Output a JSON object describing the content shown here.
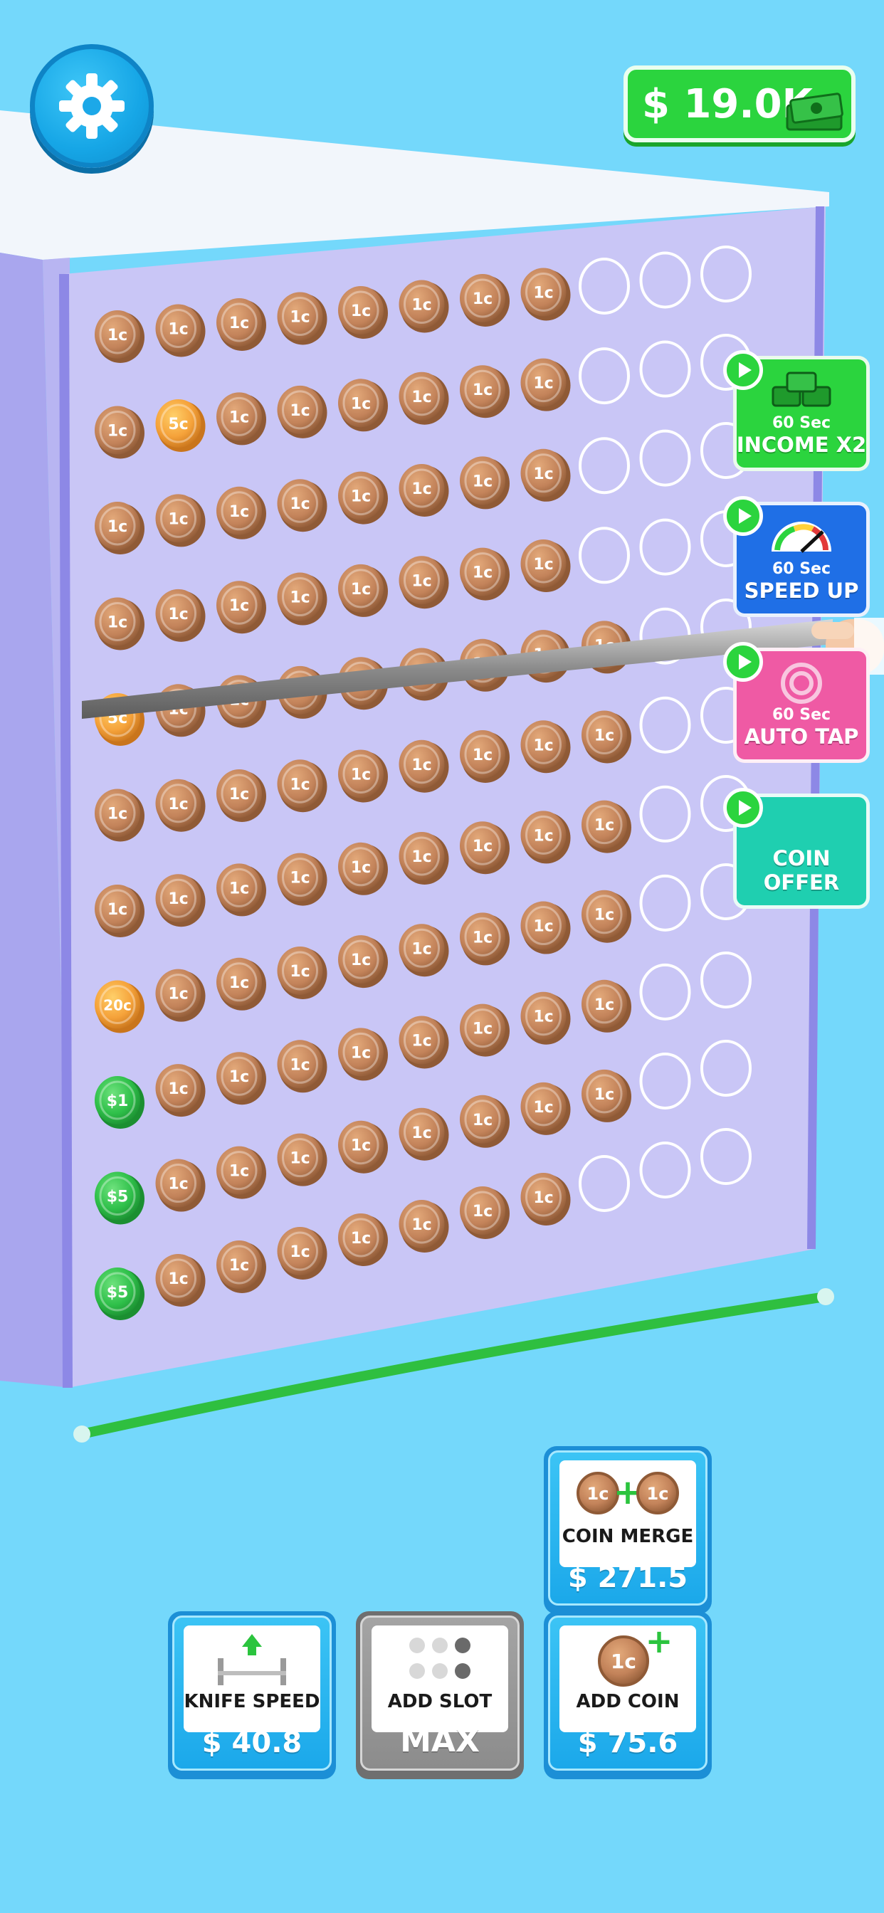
{
  "hud": {
    "money": "$ 19.0K",
    "settings_icon": "gear-icon"
  },
  "boosts": [
    {
      "timer": "60 Sec",
      "label": "INCOME X2",
      "color": "#2bd43e",
      "icon": "cash-stack-icon"
    },
    {
      "timer": "60 Sec",
      "label": "SPEED UP",
      "color": "#1f6fe6",
      "icon": "speedometer-icon"
    },
    {
      "timer": "60 Sec",
      "label": "AUTO TAP",
      "color": "#ef5aa4",
      "icon": "tap-icon"
    },
    {
      "timer": "",
      "label": "COIN OFFER",
      "color": "#1fcfb0",
      "icon": ""
    }
  ],
  "board": {
    "coin_labels": {
      "penny": "1c",
      "nickel": "5c",
      "twenty": "20c",
      "dollar": "$1",
      "five": "$5"
    },
    "rows": [
      [
        "1c",
        "1c",
        "1c",
        "1c",
        "1c",
        "1c",
        "1c",
        "1c",
        "",
        "",
        ""
      ],
      [
        "1c",
        "5c",
        "1c",
        "1c",
        "1c",
        "1c",
        "1c",
        "1c",
        "",
        "",
        ""
      ],
      [
        "1c",
        "1c",
        "1c",
        "1c",
        "1c",
        "1c",
        "1c",
        "1c",
        "",
        "",
        ""
      ],
      [
        "1c",
        "1c",
        "1c",
        "1c",
        "1c",
        "1c",
        "1c",
        "1c",
        "",
        "",
        ""
      ],
      [
        "5c",
        "1c",
        "1c",
        "1c",
        "1c",
        "1c",
        "1c",
        "1c",
        "1c",
        "",
        ""
      ],
      [
        "1c",
        "1c",
        "1c",
        "1c",
        "1c",
        "1c",
        "1c",
        "1c",
        "1c",
        "",
        ""
      ],
      [
        "1c",
        "1c",
        "1c",
        "1c",
        "1c",
        "1c",
        "1c",
        "1c",
        "1c",
        "",
        ""
      ],
      [
        "20c",
        "1c",
        "1c",
        "1c",
        "1c",
        "1c",
        "1c",
        "1c",
        "1c",
        "",
        ""
      ],
      [
        "$1",
        "1c",
        "1c",
        "1c",
        "1c",
        "1c",
        "1c",
        "1c",
        "1c",
        "",
        ""
      ],
      [
        "$5",
        "1c",
        "1c",
        "1c",
        "1c",
        "1c",
        "1c",
        "1c",
        "1c",
        "",
        ""
      ],
      [
        "$5",
        "1c",
        "1c",
        "1c",
        "1c",
        "1c",
        "1c",
        "1c",
        "",
        "",
        ""
      ]
    ]
  },
  "shop": {
    "coin_merge": {
      "label": "COIN MERGE",
      "price": "$ 271.5",
      "coin_text": "1c",
      "plus": "+"
    },
    "knife_speed": {
      "label": "KNIFE SPEED",
      "price": "$ 40.8"
    },
    "add_slot": {
      "label": "ADD SLOT",
      "price": "MAX"
    },
    "add_coin": {
      "label": "ADD COIN",
      "price": "$ 75.6",
      "coin_text": "1c",
      "plus": "+"
    }
  },
  "colors": {
    "background": "#74d8fb",
    "board_face": "#c9c6f6",
    "copper": "#c9875a",
    "nickel": "#f5a23a",
    "green_coin": "#2fc04a",
    "money_green": "#2bd43e"
  }
}
